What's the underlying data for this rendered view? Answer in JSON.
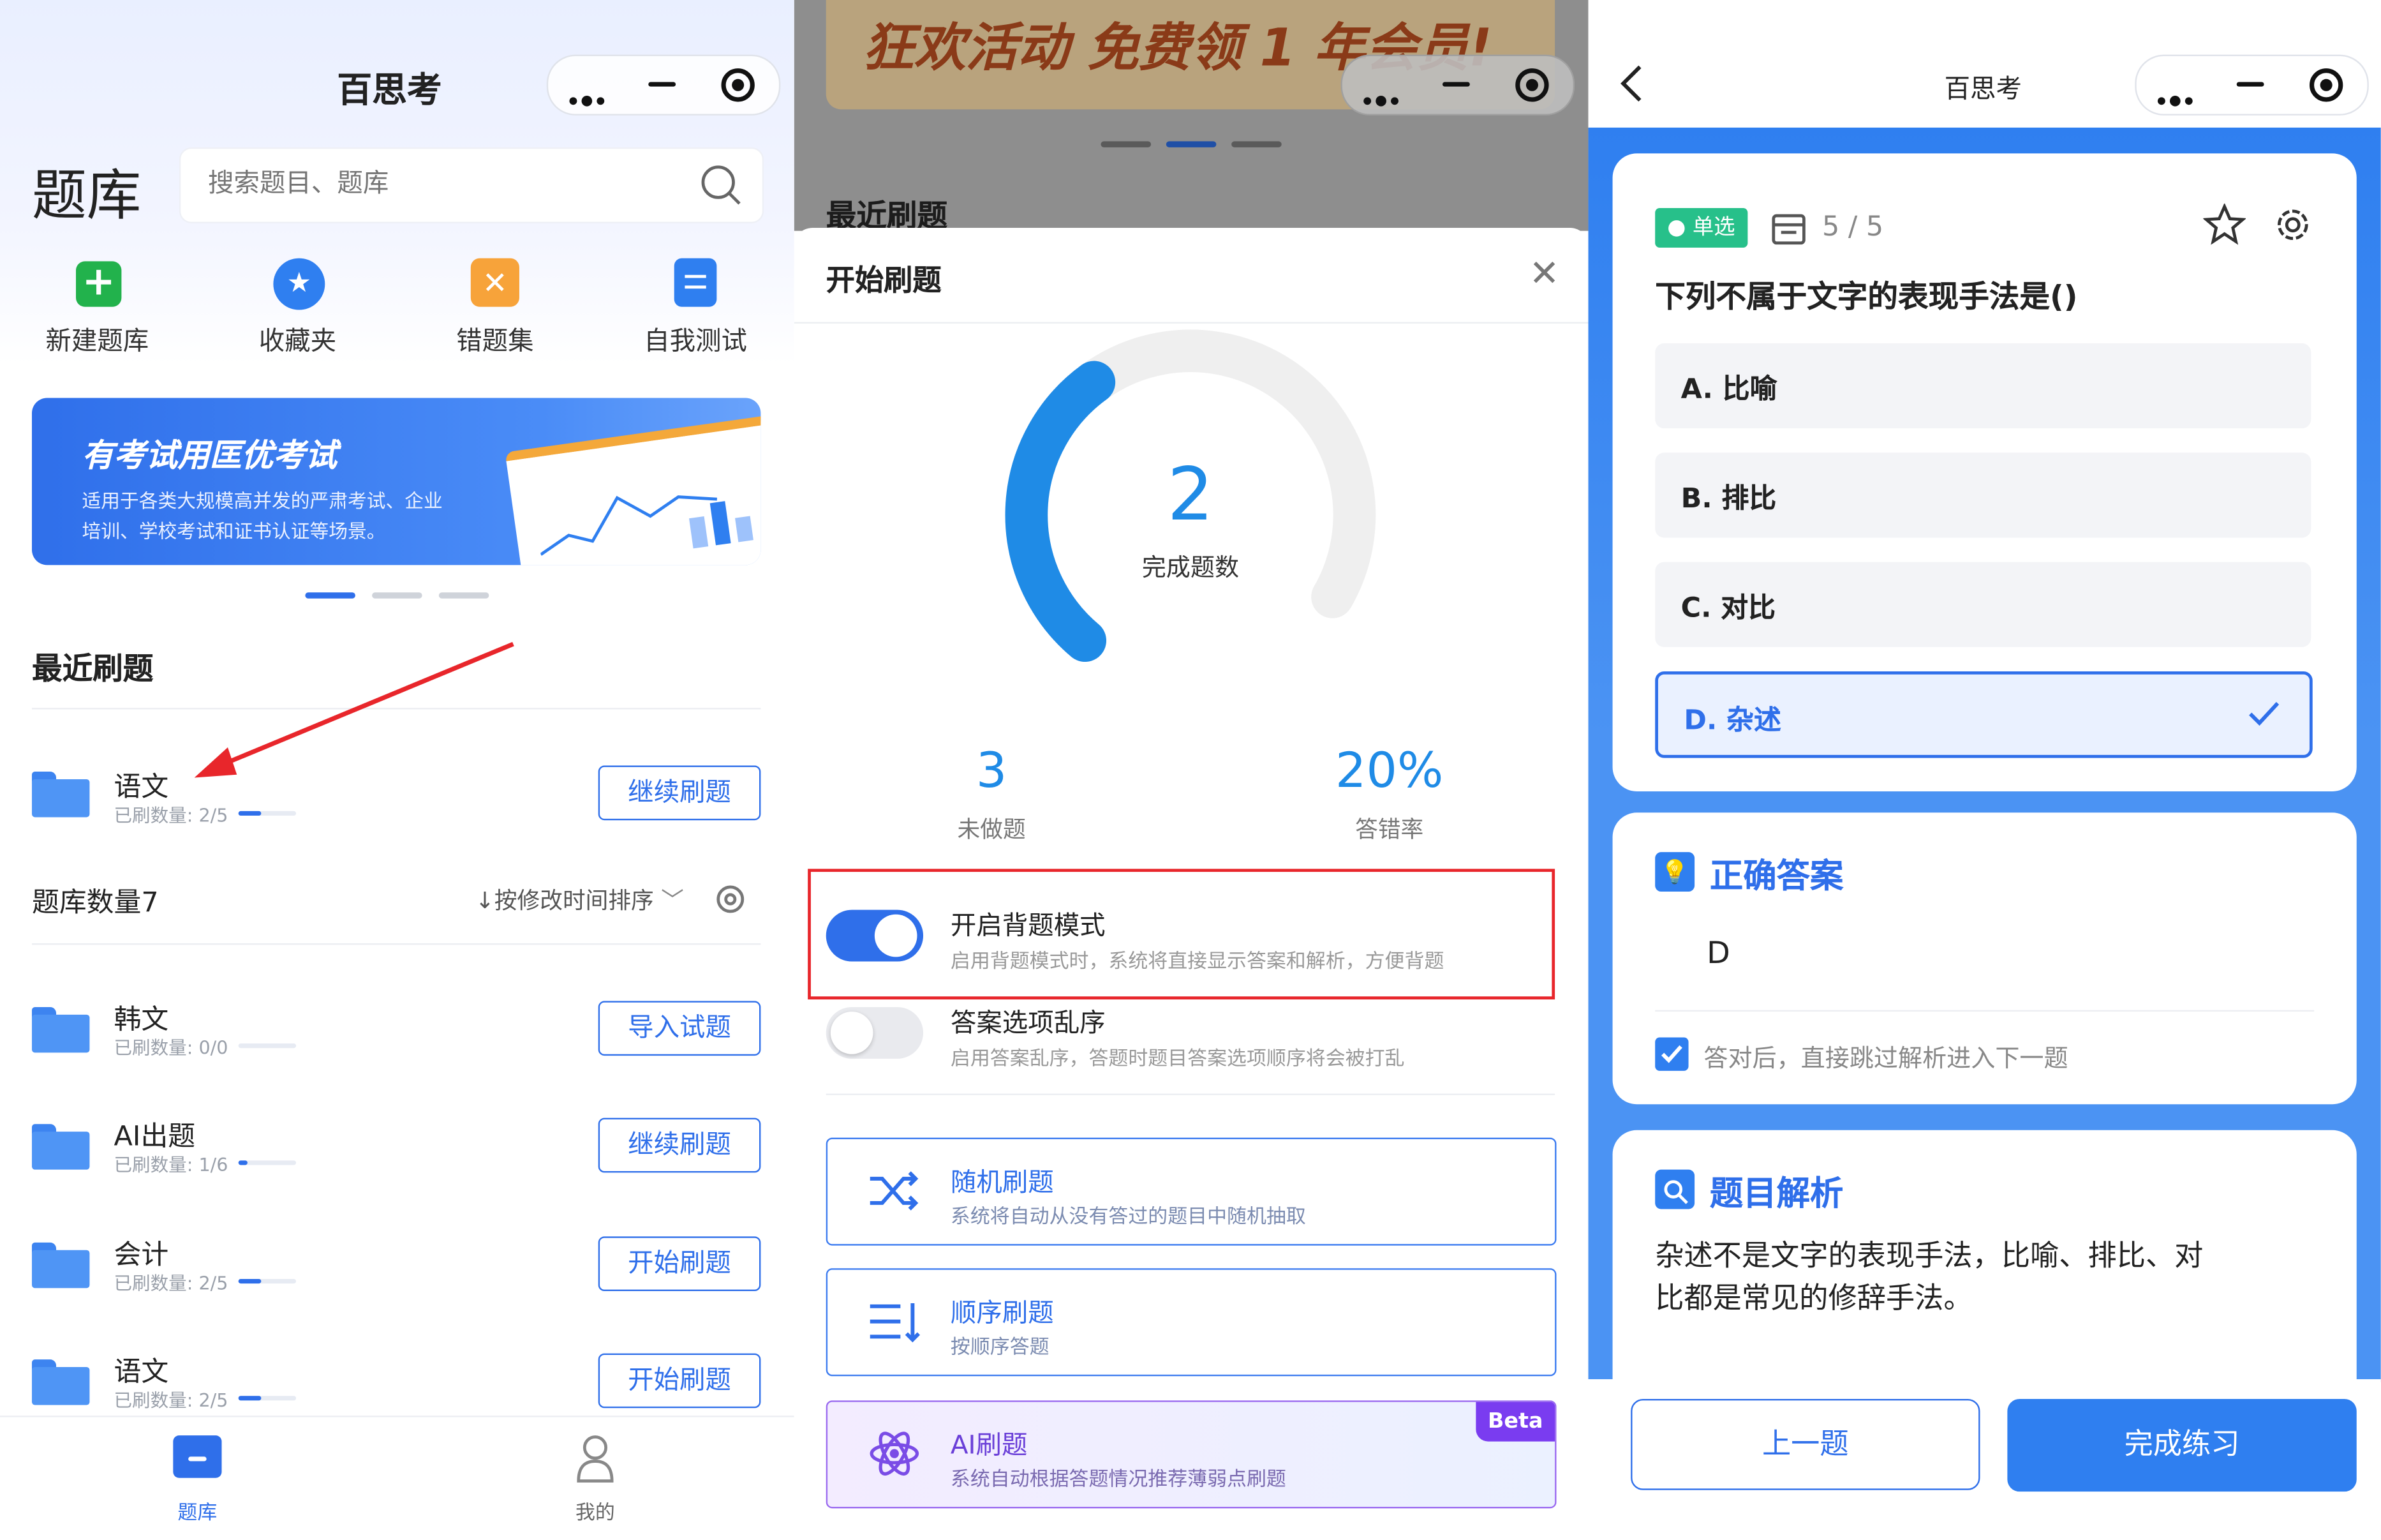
{
  "panel1": {
    "app_title": "百思考",
    "page_title": "题库",
    "search_placeholder": "搜索题目、题库",
    "shortcuts": [
      {
        "label": "新建题库",
        "icon": "plus-icon",
        "color": "#22b24c"
      },
      {
        "label": "收藏夹",
        "icon": "star-icon",
        "color": "#2f7ff0"
      },
      {
        "label": "错题集",
        "icon": "cross-icon",
        "color": "#f59a23"
      },
      {
        "label": "自我测试",
        "icon": "document-icon",
        "color": "#2f7ff0"
      }
    ],
    "banner": {
      "title": "有考试用匡优考试",
      "desc_line1": "适用于各类大规模高并发的严肃考试、企业",
      "desc_line2": "培训、学校考试和证书认证等场景。"
    },
    "recent_title": "最近刷题",
    "recent_item": {
      "name": "语文",
      "count": "已刷数量: 2/5",
      "progress": 0.4,
      "button": "继续刷题"
    },
    "bank_count_label": "题库数量7",
    "sort_label": "↓按修改时间排序",
    "banks": [
      {
        "name": "韩文",
        "count": "已刷数量: 0/0",
        "progress": 0,
        "button": "导入试题"
      },
      {
        "name": "AI出题",
        "count": "已刷数量: 1/6",
        "progress": 0.17,
        "button": "继续刷题"
      },
      {
        "name": "会计",
        "count": "已刷数量: 2/5",
        "progress": 0.4,
        "button": "开始刷题"
      },
      {
        "name": "语文",
        "count": "已刷数量: 2/5",
        "progress": 0.4,
        "button": "开始刷题"
      }
    ],
    "tabs": [
      {
        "label": "题库",
        "active": true
      },
      {
        "label": "我的",
        "active": false
      }
    ]
  },
  "panel2": {
    "banner_text": "狂欢活动 免费领 1 年会员!",
    "recent_title": "最近刷题",
    "sheet_title": "开始刷题",
    "completed": "2",
    "completed_label": "完成题数",
    "progress_fraction": 0.4,
    "undone": "3",
    "undone_label": "未做题",
    "error_rate": "20%",
    "error_rate_label": "答错率",
    "toggle_memorize": {
      "title": "开启背题模式",
      "desc": "启用背题模式时，系统将直接显示答案和解析，方便背题",
      "on": true
    },
    "toggle_shuffle": {
      "title": "答案选项乱序",
      "desc": "启用答案乱序，答题时题目答案选项顺序将会被打乱",
      "on": false
    },
    "modes": [
      {
        "title": "随机刷题",
        "desc": "系统将自动从没有答过的题目中随机抽取",
        "icon": "shuffle-icon"
      },
      {
        "title": "顺序刷题",
        "desc": "按顺序答题",
        "icon": "list-order-icon"
      },
      {
        "title": "AI刷题",
        "desc": "系统自动根据答题情况推荐薄弱点刷题",
        "icon": "atom-icon",
        "badge": "Beta"
      }
    ]
  },
  "panel3": {
    "app_title": "百思考",
    "badge": "单选",
    "counter": "5 / 5",
    "question": "下列不属于文字的表现手法是()",
    "options": [
      {
        "label": "A. 比喻",
        "selected": false
      },
      {
        "label": "B. 排比",
        "selected": false
      },
      {
        "label": "C. 对比",
        "selected": false
      },
      {
        "label": "D. 杂述",
        "selected": true
      }
    ],
    "answer_title": "正确答案",
    "answer_value": "D",
    "skip_label": "答对后，直接跳过解析进入下一题",
    "analysis_title": "题目解析",
    "analysis_line1": "杂述不是文字的表现手法，比喻、排比、对",
    "analysis_line2": "比都是常见的修辞手法。",
    "prev_button": "上一题",
    "finish_button": "完成练习",
    "accent": "#2f7ff0"
  }
}
